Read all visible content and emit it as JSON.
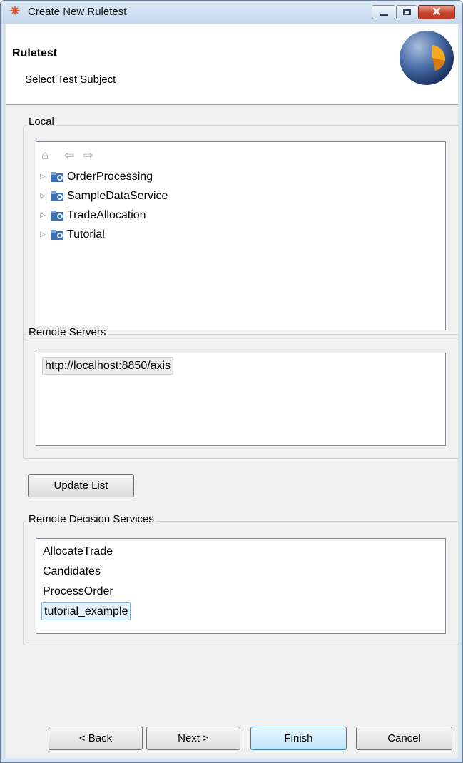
{
  "window": {
    "title": "Create New Ruletest"
  },
  "banner": {
    "title": "Ruletest",
    "subtitle": "Select Test Subject"
  },
  "local": {
    "label": "Local",
    "projects": [
      "OrderProcessing",
      "SampleDataService",
      "TradeAllocation",
      "Tutorial"
    ]
  },
  "remote_servers": {
    "label": "Remote Servers",
    "items": [
      "http://localhost:8850/axis"
    ]
  },
  "update_button": "Update List",
  "remote_services": {
    "label": "Remote Decision Services",
    "items": [
      "AllocateTrade",
      "Candidates",
      "ProcessOrder",
      "tutorial_example"
    ],
    "selected": "tutorial_example"
  },
  "buttons": {
    "back": "< Back",
    "next": "Next >",
    "finish": "Finish",
    "cancel": "Cancel"
  },
  "colors": {
    "accent": "#3c7fb1",
    "selection": "#e5f1fb",
    "close": "#c9452d"
  }
}
